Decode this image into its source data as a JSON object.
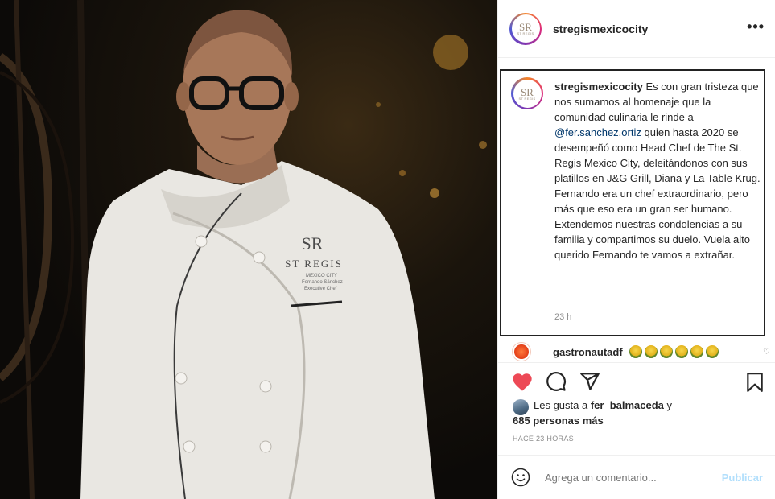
{
  "post": {
    "username": "stregismexicocity",
    "more_icon": "more-horizontal-icon",
    "avatar_logo": "SR",
    "avatar_text": "ST REGIS",
    "photo": {
      "patch_logo": "SR",
      "patch_brand": "ST REGIS",
      "patch_line1": "MEXICO CITY",
      "patch_line2": "Fernando Sánchez",
      "patch_line3": "Executive Chef"
    },
    "caption": {
      "username": "stregismexicocity",
      "text_before_mention": "Es con gran tristeza que nos sumamos al homenaje que la comunidad culinaria le rinde a",
      "mention": "@fer.sanchez.ortiz",
      "text_after_mention": "quien hasta 2020 se desempeñó como Head Chef de The St. Regis Mexico City, deleitándonos con sus platillos en J&G Grill, Diana y La Table Krug. Fernando era un chef extraordinario, pero más que eso era un gran ser humano. Extendemos nuestras condolencias a su familia y compartimos su duelo. Vuela alto querido Fernando te vamos a extrañar.",
      "time": "23 h"
    },
    "comment": {
      "username": "gastronautadf",
      "emoji_count": 6
    },
    "likes": {
      "prefix": "Les gusta a",
      "liker": "fer_balmaceda",
      "joiner": "y",
      "others": "685 personas más"
    },
    "posted_ago": "HACE 23 HORAS",
    "add_comment": {
      "placeholder": "Agrega un comentario...",
      "post_label": "Publicar"
    },
    "colors": {
      "heart": "#ed4956",
      "link": "#00376b",
      "post_disabled": "#b2dffc"
    }
  }
}
